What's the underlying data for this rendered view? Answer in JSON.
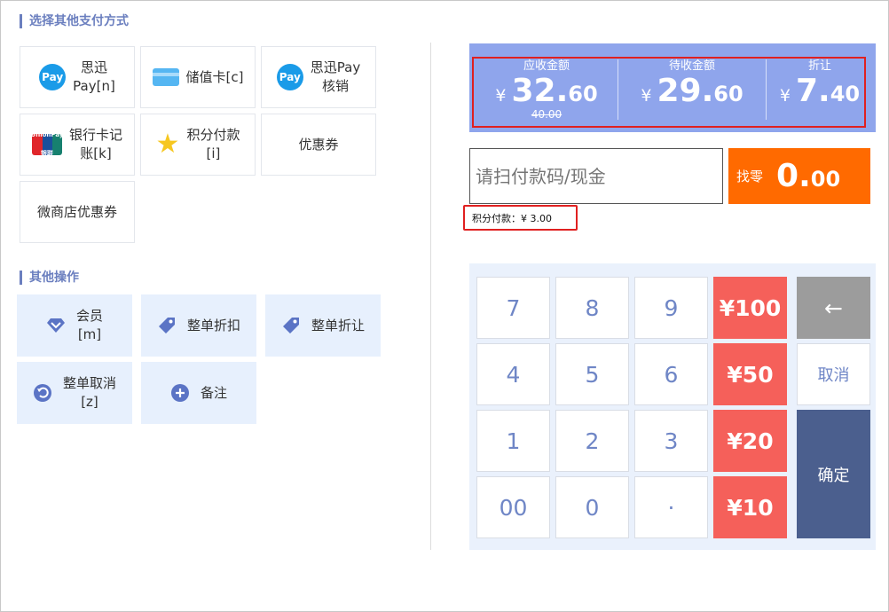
{
  "pay_section": {
    "title": "选择其他支付方式",
    "buttons": [
      {
        "label": "思迅\nPay[n]",
        "icon": "pay-icon"
      },
      {
        "label": "储值卡[c]",
        "icon": "card-icon"
      },
      {
        "label": "思迅Pay\n核销",
        "icon": "pay-icon"
      },
      {
        "label": "银行卡记\n账[k]",
        "icon": "unionpay-icon"
      },
      {
        "label": "积分付款\n[i]",
        "icon": "star-icon"
      },
      {
        "label": "优惠券",
        "icon": ""
      },
      {
        "label": "微商店优惠券",
        "icon": ""
      }
    ],
    "pay_icon_text": "Pay",
    "unionpay_icon_text": "UnionPay 银联"
  },
  "ops_section": {
    "title": "其他操作",
    "buttons": [
      {
        "label": "会员\n[m]",
        "icon": "diamond-icon"
      },
      {
        "label": "整单折扣",
        "icon": "tag-icon"
      },
      {
        "label": "整单折让",
        "icon": "tag-icon"
      },
      {
        "label": "整单取消\n[z]",
        "icon": "undo-icon"
      },
      {
        "label": "备注",
        "icon": "plus-circle-icon"
      }
    ]
  },
  "summary": {
    "currency": "¥",
    "receivable": {
      "label": "应收金额",
      "int": "32.",
      "dec": "60",
      "original": "40.00"
    },
    "pending": {
      "label": "待收金额",
      "int": "29.",
      "dec": "60"
    },
    "discount": {
      "label": "折让",
      "int": "7.",
      "dec": "40"
    }
  },
  "scan_input": {
    "placeholder": "请扫付款码/现金",
    "value": ""
  },
  "change": {
    "label": "找零",
    "int": "0.",
    "dec": "00"
  },
  "points_note": "积分付款：¥ 3.00",
  "keypad": {
    "digits": [
      "7",
      "8",
      "9",
      "4",
      "5",
      "6",
      "1",
      "2",
      "3",
      "00",
      "0",
      "·"
    ],
    "money": [
      "¥100",
      "¥50",
      "¥20",
      "¥10"
    ],
    "backspace": "←",
    "cancel": "取消",
    "confirm": "确定"
  },
  "colors": {
    "accent": "#6b7fbf",
    "summary_bg": "#8fa5ec",
    "change_bg": "#ff6a00",
    "money_key": "#f5605a",
    "confirm_key": "#4b5f8e",
    "highlight_border": "#e02020"
  }
}
